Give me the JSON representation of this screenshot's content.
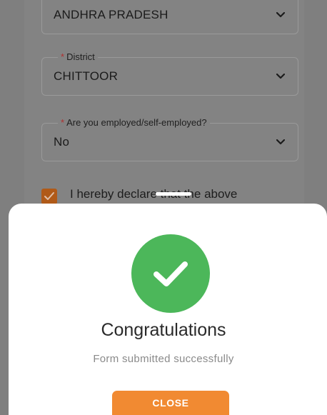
{
  "form": {
    "state": {
      "value": "ANDHRA PRADESH",
      "icon": "chevron-down-icon"
    },
    "district": {
      "label_required": "*",
      "label": "District",
      "value": "CHITTOOR",
      "icon": "chevron-down-icon"
    },
    "employment": {
      "label_required": "*",
      "label": "Are you employed/self-employed?",
      "value": "No",
      "icon": "chevron-down-icon"
    },
    "declaration": {
      "checked": true,
      "text": "I hereby declare that the above"
    }
  },
  "dialog": {
    "icon": "check-circle-icon",
    "title": "Congratulations",
    "message": "Form submitted successfully",
    "close_label": "CLOSE"
  },
  "colors": {
    "success_green": "#4cb75a",
    "accent_orange": "#f18a32"
  }
}
